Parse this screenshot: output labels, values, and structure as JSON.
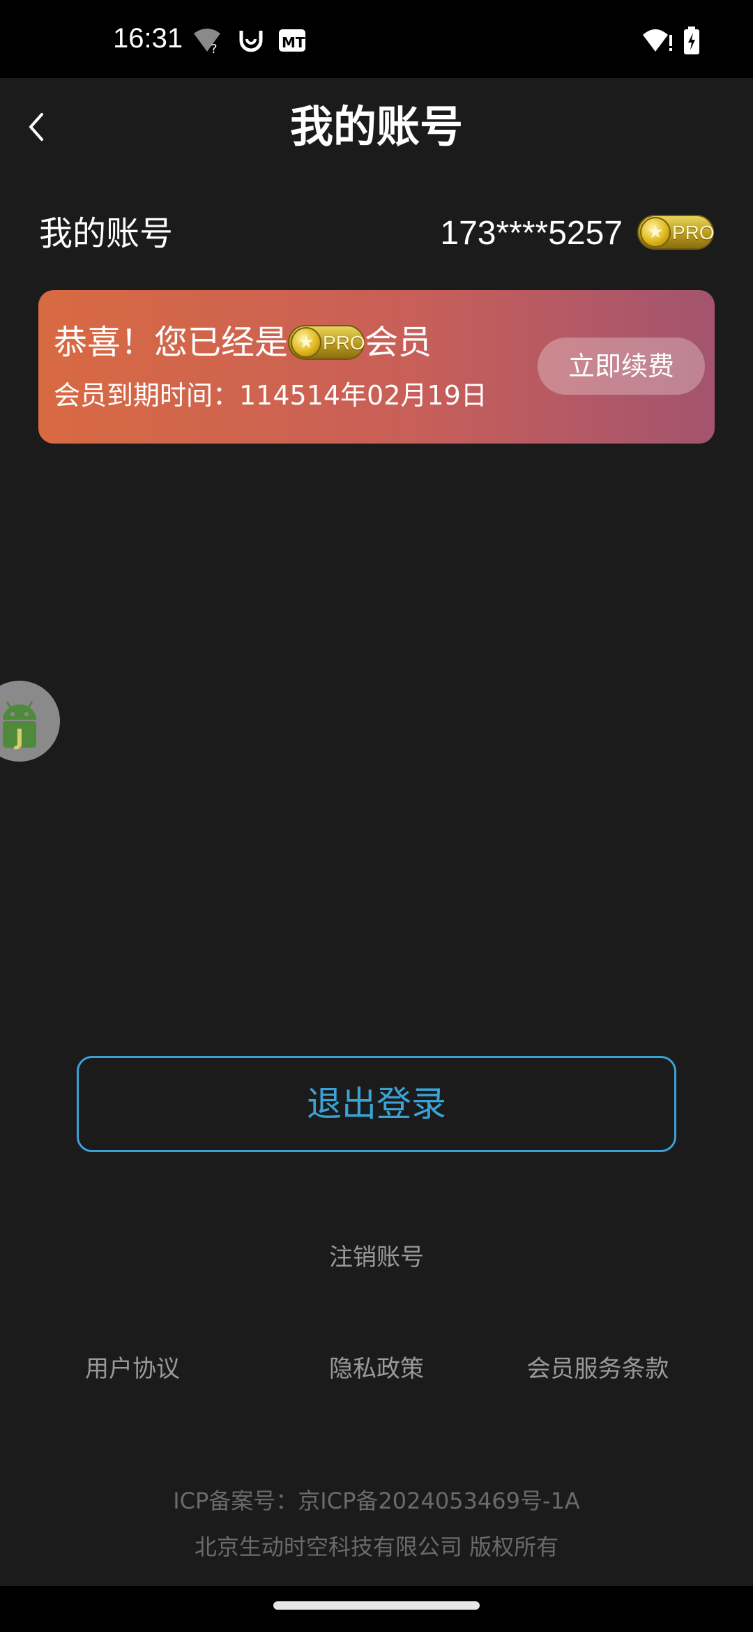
{
  "status_bar": {
    "time": "16:31",
    "icons": [
      "wifi-question-icon",
      "app-notification-icon",
      "mt-icon",
      "wifi-icon",
      "battery-charging-icon"
    ]
  },
  "header": {
    "title": "我的账号",
    "back_icon": "chevron-left-icon"
  },
  "account": {
    "label": "我的账号",
    "number": "173****5257",
    "badge_text": "PRO"
  },
  "member_card": {
    "congrats_prefix": "恭喜！您已经是",
    "congrats_suffix": "会员",
    "badge_text": "PRO",
    "expiry": "会员到期时间：114514年02月19日",
    "renew_label": "立即续费"
  },
  "floating_button": {
    "icon": "android-debug-icon",
    "letter": "J"
  },
  "logout_label": "退出登录",
  "cancel_account_label": "注销账号",
  "links": {
    "user_agreement": "用户协议",
    "privacy_policy": "隐私政策",
    "member_terms": "会员服务条款"
  },
  "footer": {
    "icp": "ICP备案号：京ICP备2024053469号-1A",
    "copyright": "北京生动时空科技有限公司 版权所有"
  },
  "colors": {
    "background": "#1b1b1b",
    "accent_blue": "#3aa3d6",
    "card_start": "#d86a42",
    "card_end": "#a3546f",
    "muted_text": "#9a9a9a"
  }
}
